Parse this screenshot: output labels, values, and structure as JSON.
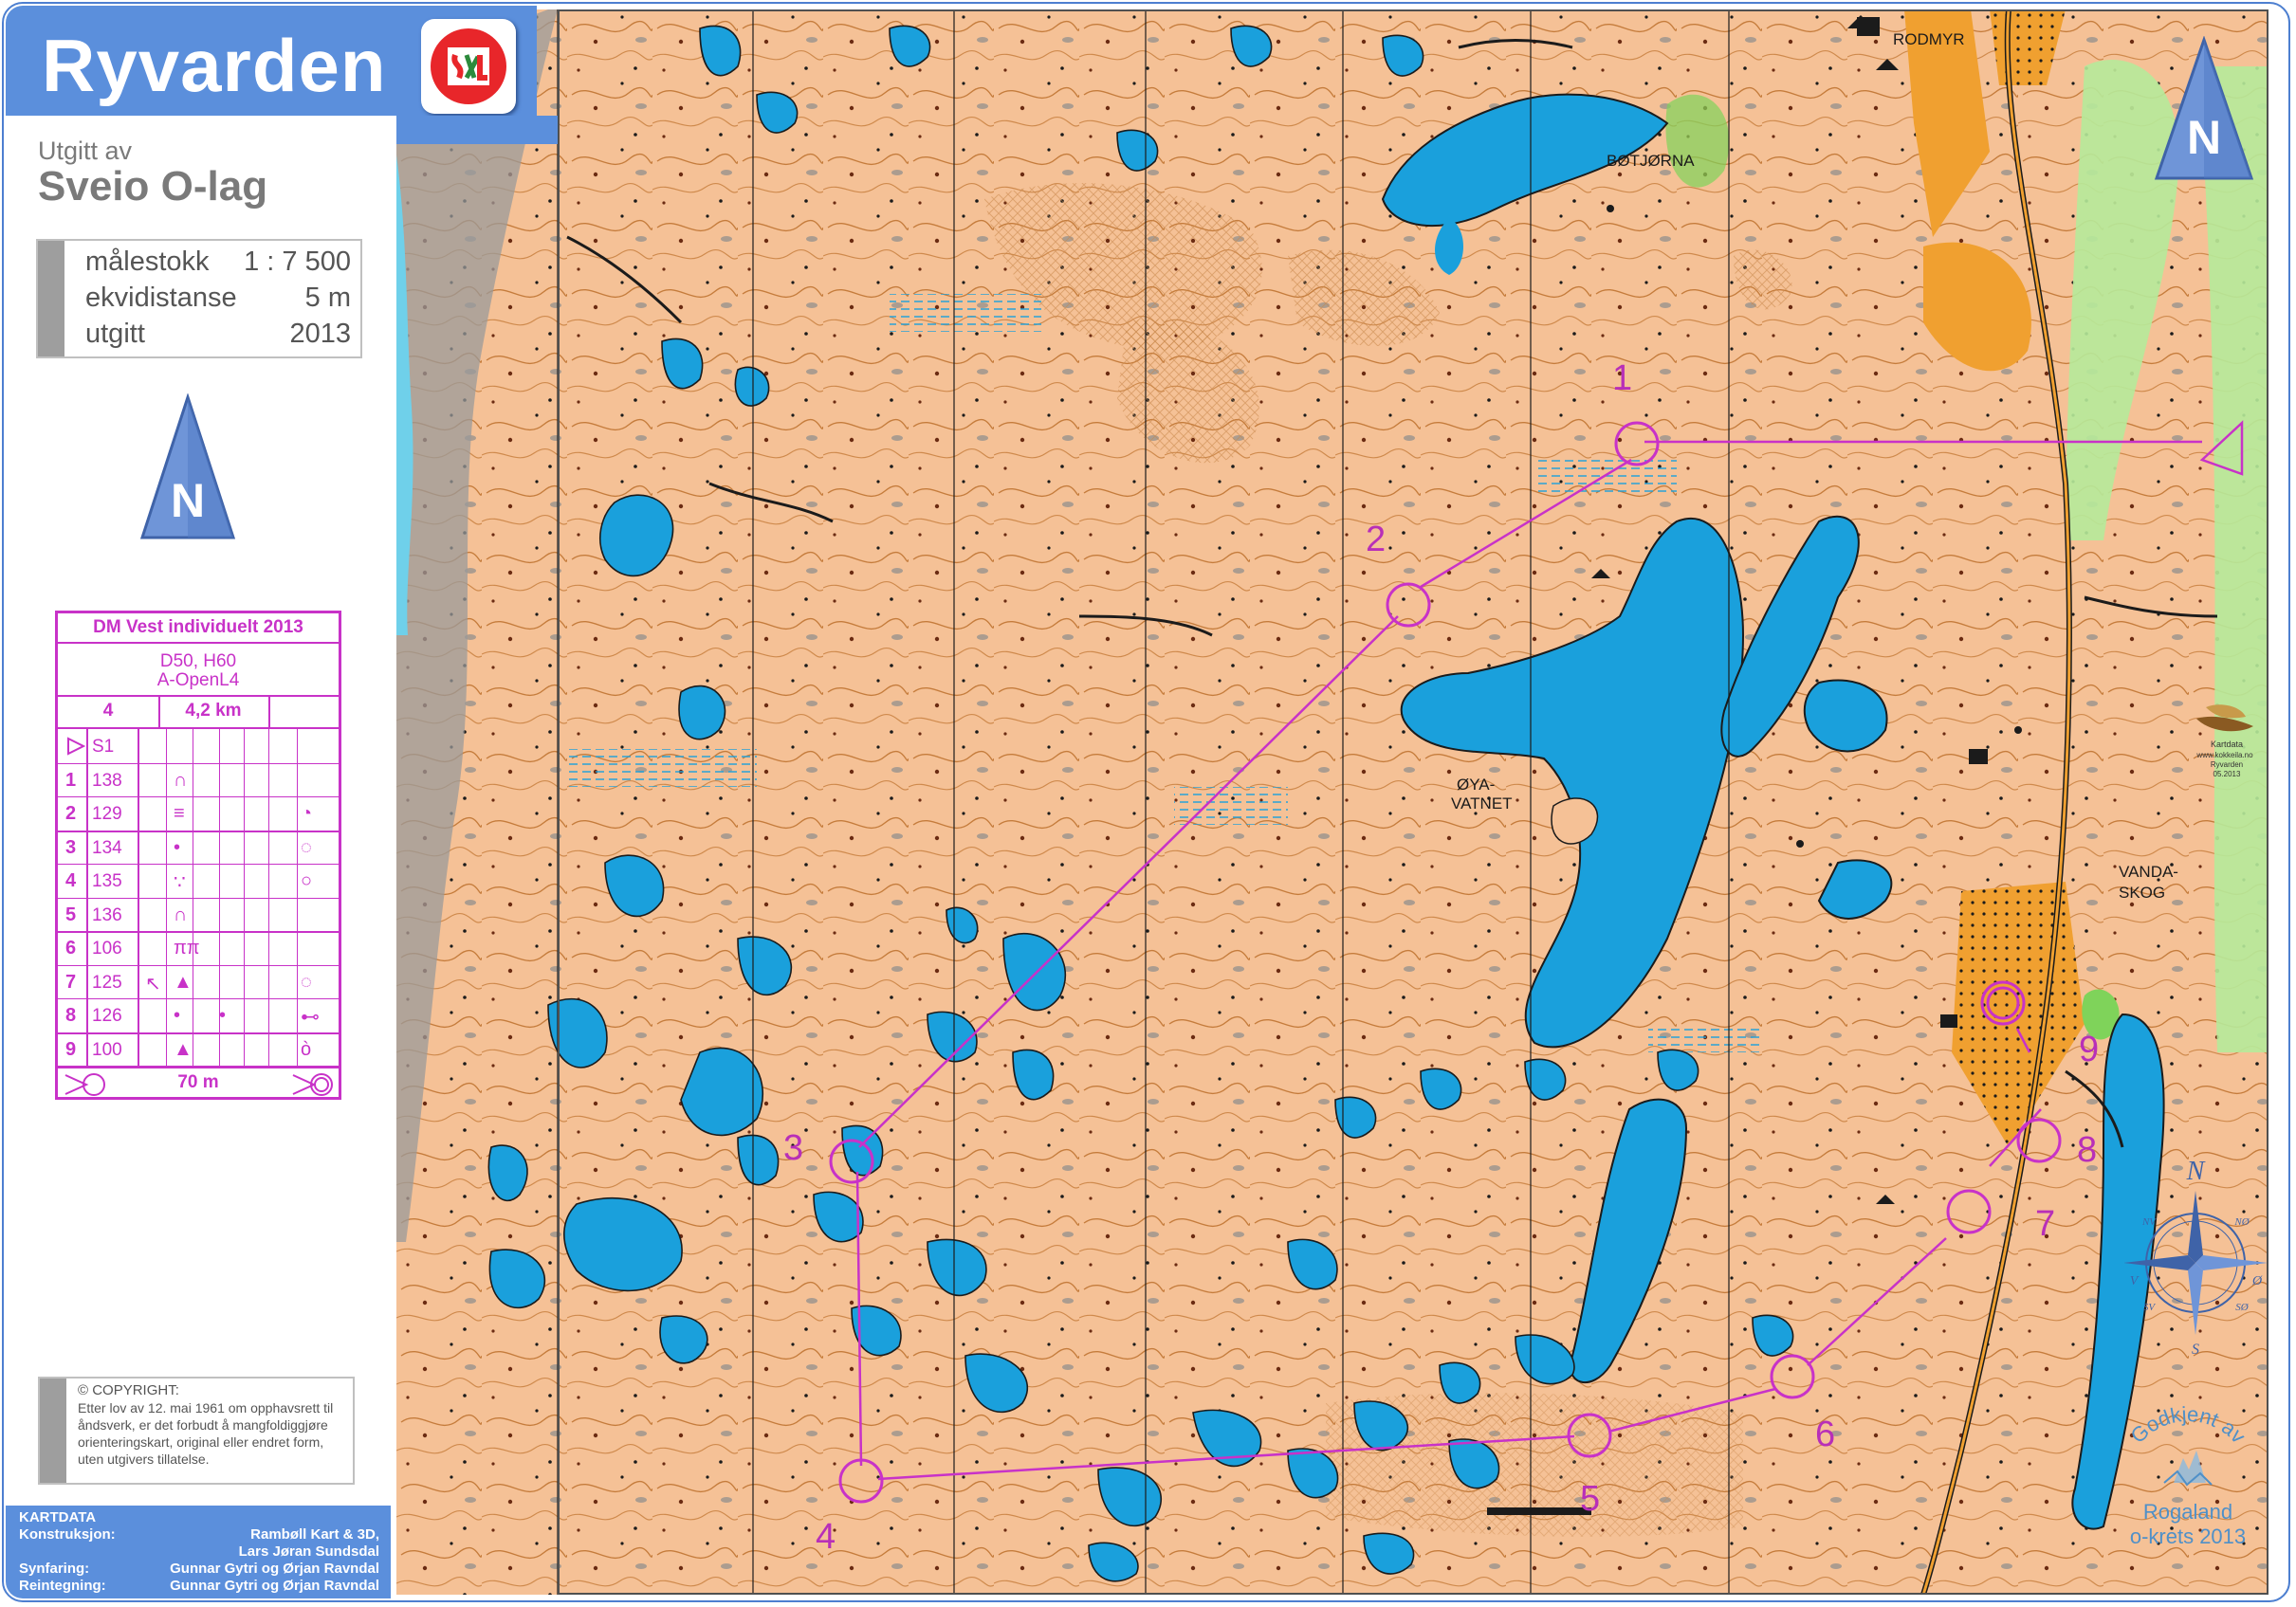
{
  "title": "Ryvarden",
  "club_logo": {
    "text": "S+L",
    "icon": "club-logo-icon"
  },
  "publisher": {
    "prefix": "Utgitt av",
    "name": "Sveio O-lag"
  },
  "meta": [
    {
      "label": "målestokk",
      "value": "1 : 7 500"
    },
    {
      "label": "ekvidistanse",
      "value": "5 m"
    },
    {
      "label": "utgitt",
      "value": "2013"
    }
  ],
  "north_label": "N",
  "description": {
    "event": "DM Vest individuelt 2013",
    "classes": "D50, H60",
    "course": "A-OpenL4",
    "course_number": "4",
    "length": "4,2 km",
    "start": {
      "id": "S1"
    },
    "controls": [
      {
        "n": "1",
        "code": "138",
        "sym_d": "",
        "sym_e": "∩",
        "sym_f": "",
        "sym_h": ""
      },
      {
        "n": "2",
        "code": "129",
        "sym_d": "",
        "sym_e": "≡",
        "sym_f": "",
        "sym_h": "◔"
      },
      {
        "n": "3",
        "code": "134",
        "sym_d": "",
        "sym_e": "•",
        "sym_f": "",
        "sym_h": "◌"
      },
      {
        "n": "4",
        "code": "135",
        "sym_d": "",
        "sym_e": "∵",
        "sym_f": "",
        "sym_h": "○"
      },
      {
        "n": "5",
        "code": "136",
        "sym_d": "",
        "sym_e": "∩",
        "sym_f": "",
        "sym_h": ""
      },
      {
        "n": "6",
        "code": "106",
        "sym_d": "",
        "sym_e": "ππ",
        "sym_f": "",
        "sym_h": ""
      },
      {
        "n": "7",
        "code": "125",
        "sym_d": "↖",
        "sym_e": "▲",
        "sym_f": "",
        "sym_h": "◌"
      },
      {
        "n": "8",
        "code": "126",
        "sym_d": "",
        "sym_e": "•",
        "sym_f": "•",
        "sym_h": "⊷"
      },
      {
        "n": "9",
        "code": "100",
        "sym_d": "",
        "sym_e": "▲",
        "sym_f": "",
        "sym_h": "ò"
      }
    ],
    "finish_distance": "70 m"
  },
  "copyright": {
    "title": "© COPYRIGHT:",
    "body": "Etter lov av 12. mai 1961 om opphavsrett til åndsverk, er det forbudt å mangfoldiggjøre orienteringskart, original eller endret form, uten utgivers tillatelse."
  },
  "credits": {
    "header": "KARTDATA",
    "rows": [
      {
        "k": "Konstruksjon:",
        "v": "Rambøll Kart & 3D,"
      },
      {
        "k": "",
        "v": "Lars Jøran Sundsdal"
      },
      {
        "k": "Synfaring:",
        "v": "Gunnar Gytri og Ørjan Ravndal"
      },
      {
        "k": "Reintegning:",
        "v": "Gunnar Gytri og Ørjan Ravndal"
      }
    ]
  },
  "map": {
    "place_names": [
      "RODMYR",
      "BØTJØRNA",
      "ØYA-",
      "VATNET",
      "VANDA-",
      "SKOG"
    ],
    "control_numbers": [
      "1",
      "2",
      "3",
      "4",
      "5",
      "6",
      "7",
      "8",
      "9"
    ],
    "colors": {
      "terrain": "#f5c196",
      "water": "#1aa0dc",
      "course": "#c832c8",
      "vegetation": "#7fd35a",
      "rock": "#9a9a9a",
      "road": "#f0a030"
    }
  },
  "mapper_logo": {
    "line1": "Kartdata",
    "line2": "www.kokkeila.no",
    "line3": "Ryvarden",
    "line4": "05.2013"
  },
  "compass": {
    "n": "N",
    "s": "S",
    "e": "Ø",
    "w": "V",
    "ne": "NØ",
    "nw": "NV",
    "se": "SØ",
    "sw": "SV"
  },
  "approved": {
    "arc": "Godkjent av",
    "line1": "Rogaland",
    "line2": "o-krets 2013"
  }
}
